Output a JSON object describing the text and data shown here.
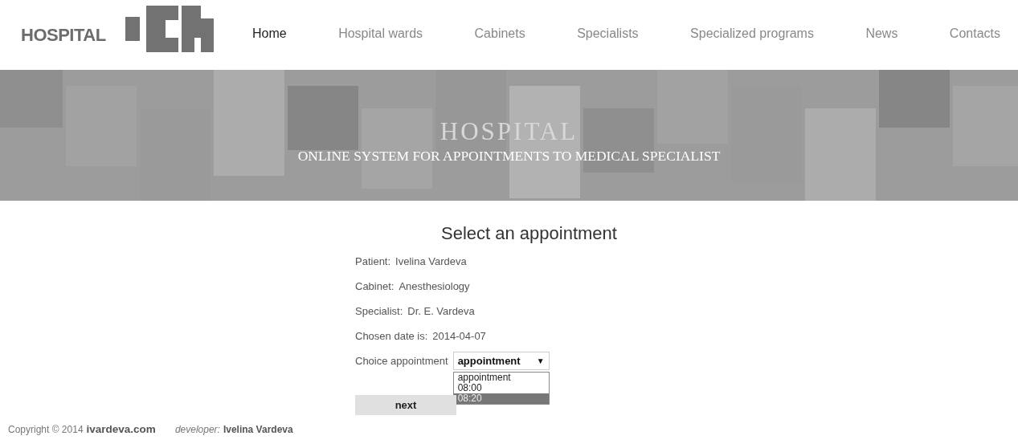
{
  "header": {
    "logo_text": "HOSPITAL"
  },
  "nav": [
    {
      "label": "Home",
      "selected": true
    },
    {
      "label": "Hospital wards",
      "selected": false
    },
    {
      "label": "Cabinets",
      "selected": false
    },
    {
      "label": "Specialists",
      "selected": false
    },
    {
      "label": "Specialized programs",
      "selected": false
    },
    {
      "label": "News",
      "selected": false
    },
    {
      "label": "Contacts",
      "selected": false
    }
  ],
  "banner": {
    "title": "HOSPITAL",
    "subtitle": "ONLINE SYSTEM FOR APPOINTMENTS TO MEDICAL SPECIALIST"
  },
  "heading": "Select an appointment",
  "details": [
    {
      "label": "Patient:",
      "value": "Ivelina Vardeva"
    },
    {
      "label": "Cabinet:",
      "value": "Anesthesiology"
    },
    {
      "label": "Specialist:",
      "value": "Dr. E. Vardeva"
    },
    {
      "label": "Chosen date is:",
      "value": "2014-04-07"
    }
  ],
  "appointment": {
    "label": "Choice appointment",
    "value": "appointment",
    "caret": "▼",
    "options": [
      {
        "label": "appointment",
        "highlighted": false
      },
      {
        "label": "08:00",
        "highlighted": false
      },
      {
        "label": "08:20",
        "highlighted": true
      }
    ]
  },
  "next_button": "next",
  "footer": {
    "copyright": "Copyright © 2014",
    "site": "ivardeva.com",
    "developer_label": "developer:",
    "developer": "Ivelina Vardeva"
  }
}
